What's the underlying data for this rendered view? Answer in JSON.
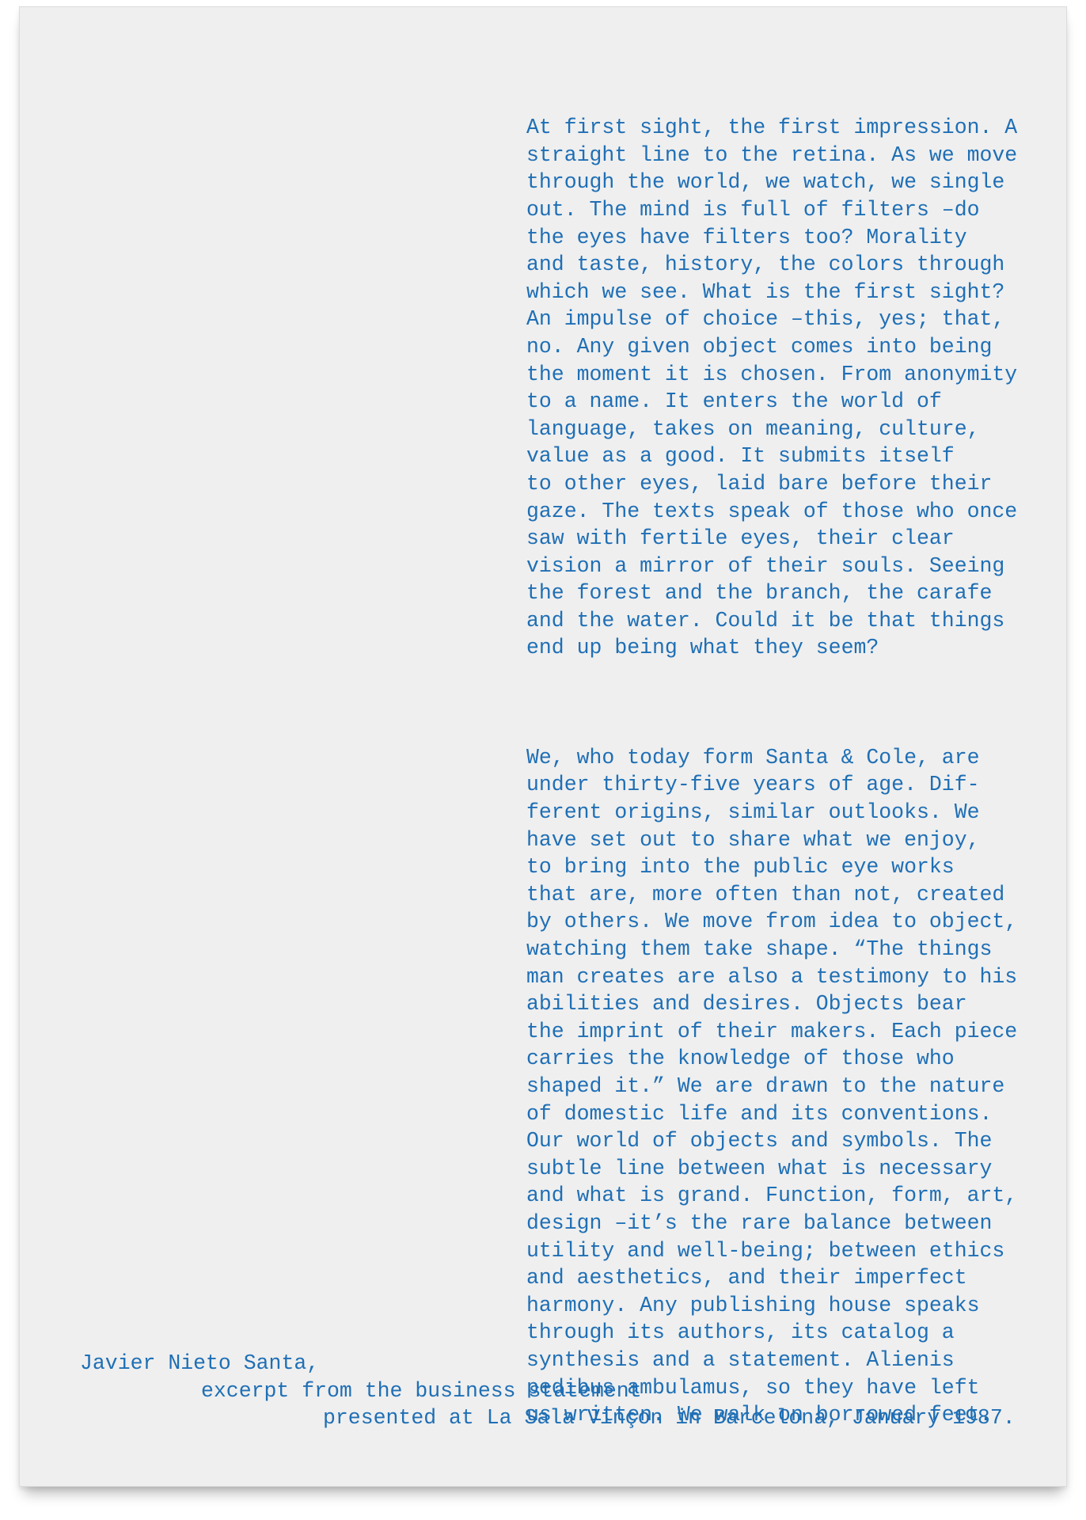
{
  "document": {
    "paragraphs": [
      "At first sight, the first impression. A\nstraight line to the retina. As we move\nthrough the world, we watch, we single\nout. The mind is full of filters –do\nthe eyes have filters too? Morality\nand taste, history, the colors through\nwhich we see. What is the first sight?\nAn impulse of choice –this, yes; that,\nno. Any given object comes into being\nthe moment it is chosen. From anonymity\nto a name. It enters the world of\nlanguage, takes on meaning, culture,\nvalue as a good. It submits itself\nto other eyes, laid bare before their\ngaze. The texts speak of those who once\nsaw with fertile eyes, their clear\nvision a mirror of their souls. Seeing\nthe forest and the branch, the carafe\nand the water. Could it be that things\nend up being what they seem?",
      "We, who today form Santa & Cole, are\nunder thirty-five years of age. Dif-\nferent origins, similar outlooks. We\nhave set out to share what we enjoy,\nto bring into the public eye works\nthat are, more often than not, created\nby others. We move from idea to object,\nwatching them take shape. “The things\nman creates are also a testimony to his\nabilities and desires. Objects bear\nthe imprint of their makers. Each piece\ncarries the knowledge of those who\nshaped it.” We are drawn to the nature\nof domestic life and its conventions.\nOur world of objects and symbols. The\nsubtle line between what is necessary\nand what is grand. Function, form, art,\ndesign –it’s the rare balance between\nutility and well-being; between ethics\nand aesthetics, and their imperfect\nharmony. Any publishing house speaks\nthrough its authors, its catalog a\nsynthesis and a statement. Alienis\npedibus ambulamus, so they have left\nus written. We walk on borrowed feet."
    ],
    "signature": {
      "author": "Javier Nieto Santa,",
      "source": "excerpt from the business statement",
      "venue": "presented at La Sala Vinçon in Barcelona, January 1987."
    },
    "colors": {
      "text": "#1f6fb5",
      "paper": "#efefef"
    }
  }
}
